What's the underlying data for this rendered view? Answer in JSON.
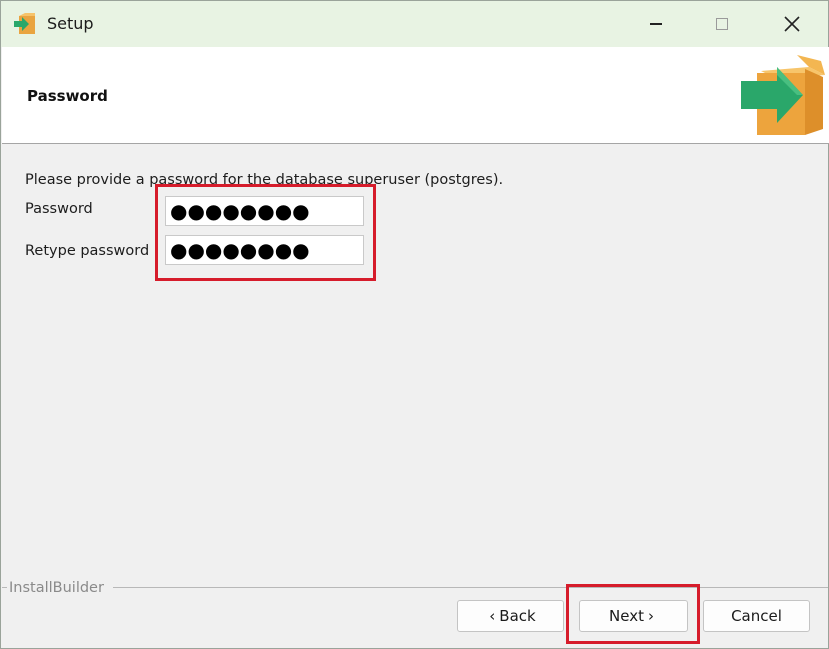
{
  "window": {
    "title": "Setup"
  },
  "header": {
    "title": "Password"
  },
  "main": {
    "instructions": "Please provide a password for the database superuser (postgres).",
    "password": {
      "label": "Password",
      "masked_value": "●●●●●●●●"
    },
    "retype": {
      "label": "Retype password",
      "masked_value": "●●●●●●●●"
    }
  },
  "footer": {
    "brand": "InstallBuilder",
    "back_label": "Back",
    "next_label": "Next",
    "cancel_label": "Cancel"
  },
  "colors": {
    "highlight": "#d61c2b",
    "titlebar": "#e8f3e3",
    "accent_green": "#2aa76a",
    "box_orange": "#f0a63a"
  }
}
